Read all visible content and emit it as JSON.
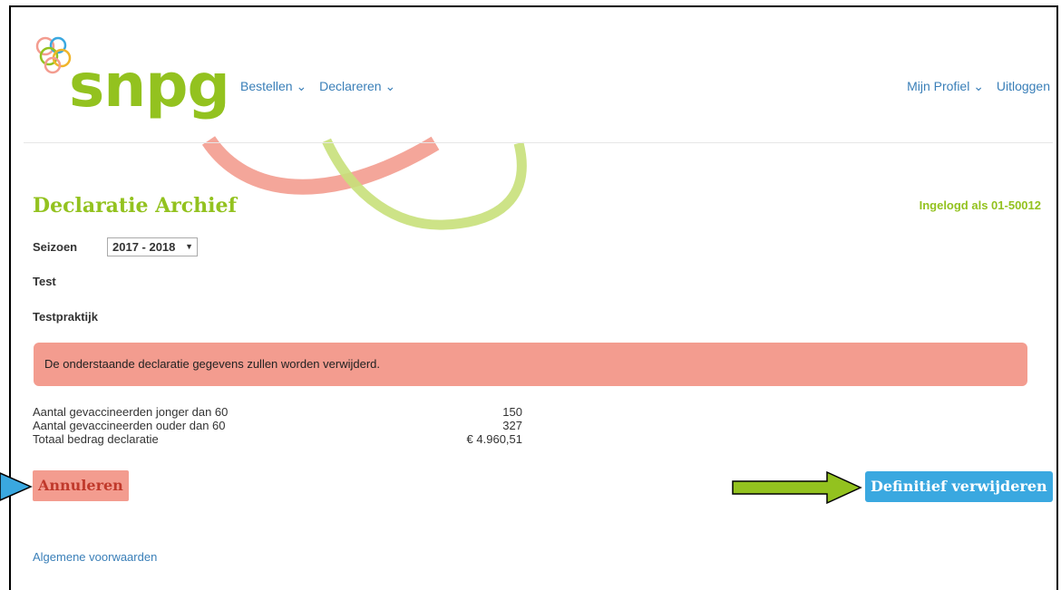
{
  "header": {
    "brand": "snpg",
    "nav_left": [
      "Bestellen ⌄",
      "Declareren ⌄"
    ],
    "nav_right": [
      "Mijn Profiel ⌄",
      "Uitloggen"
    ]
  },
  "main": {
    "title": "Declaratie Archief",
    "login_status": "Ingelogd als 01-50012",
    "season_label": "Seizoen",
    "season_value": "2017 - 2018",
    "practice_name": "Test",
    "practice_type": "Testpraktijk",
    "alert": "De onderstaande declaratie gegevens zullen worden verwijderd.",
    "summary": [
      {
        "label": "Aantal gevaccineerden jonger dan 60",
        "value": "150"
      },
      {
        "label": "Aantal gevaccineerden ouder dan 60",
        "value": "327"
      },
      {
        "label": "Totaal bedrag declaratie",
        "value": "€ 4.960,51"
      }
    ],
    "cancel_label": "Annuleren",
    "delete_label": "Definitief verwijderen"
  },
  "footer": {
    "terms_link": "Algemene voorwaarden"
  },
  "colors": {
    "brand_green": "#93c21f",
    "alert_red": "#f39c8f",
    "button_blue": "#3aa8e0",
    "link_blue": "#3a7fb8"
  }
}
